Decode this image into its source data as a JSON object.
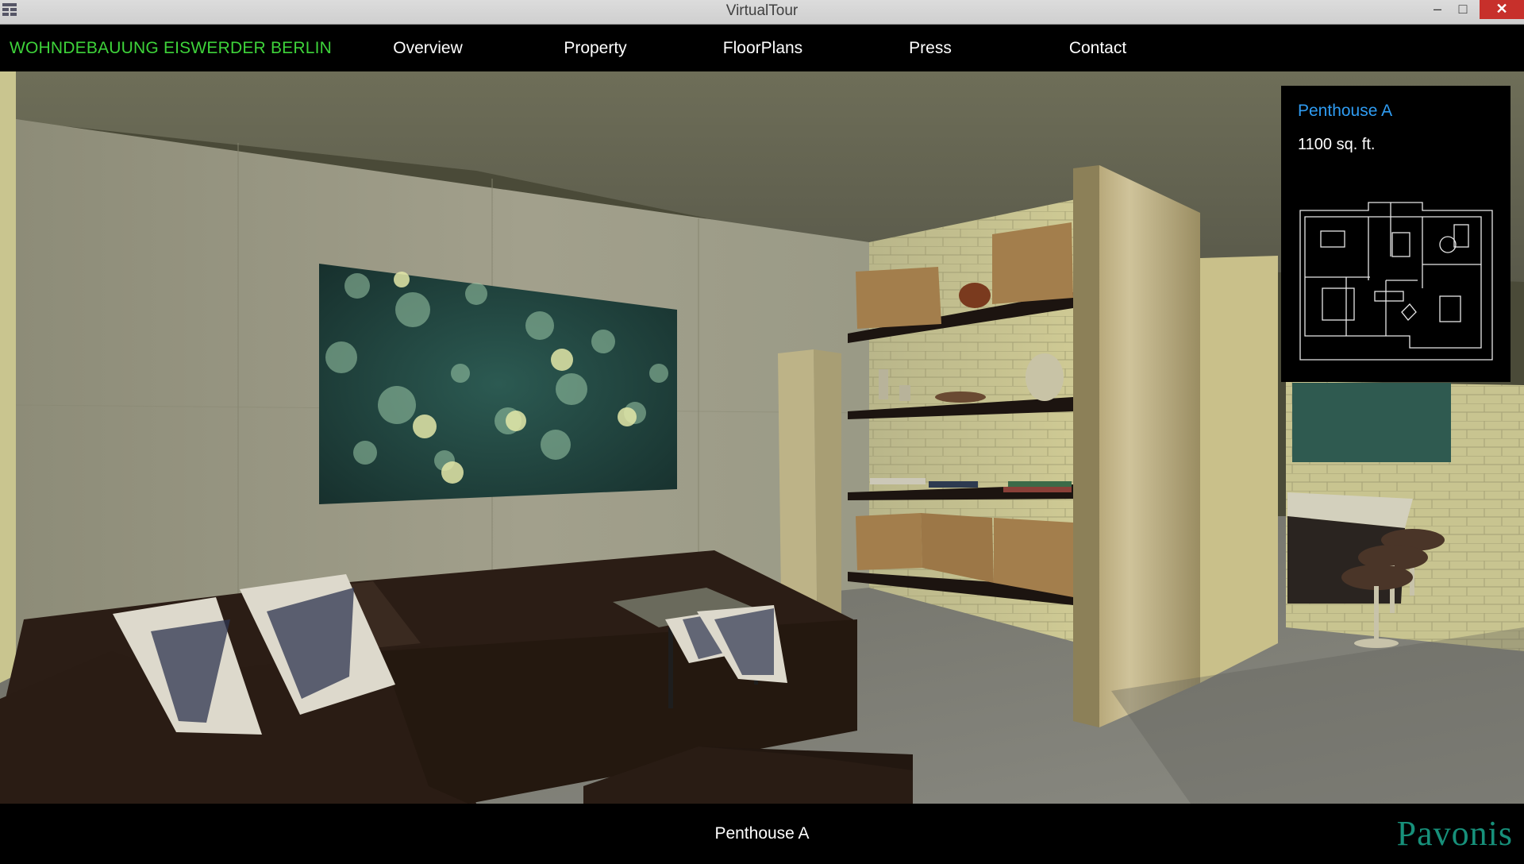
{
  "window": {
    "title": "VirtualTour",
    "minimize_glyph": "–",
    "maximize_glyph": "□",
    "close_glyph": "✕"
  },
  "nav": {
    "brand": "WOHNDEBAUUNG EISWERDER BERLIN",
    "items": [
      "Overview",
      "Property",
      "FloorPlans",
      "Press",
      "Contact"
    ]
  },
  "info_panel": {
    "title": "Penthouse A",
    "area": "1100 sq. ft."
  },
  "footer": {
    "caption": "Penthouse A",
    "logo": "Pavonis"
  },
  "colors": {
    "brand_green": "#3ed33a",
    "panel_title_blue": "#2f9cf2",
    "logo_teal": "#17907a",
    "close_red": "#c7302b"
  },
  "icons": [
    "app-icon",
    "minimize-icon",
    "maximize-icon",
    "close-icon"
  ]
}
